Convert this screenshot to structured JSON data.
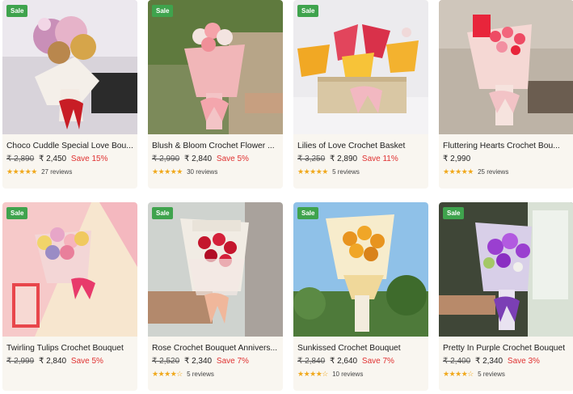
{
  "products": [
    {
      "title": "Choco Cuddle Special Love Bou...",
      "badge": "Sale",
      "old_price": "₹ 2,890",
      "price": "₹ 2,450",
      "save": "Save 15%",
      "stars": "★★★★★",
      "rating": 4.5,
      "reviews": "27 reviews"
    },
    {
      "title": "Blush & Bloom Crochet Flower ...",
      "badge": "Sale",
      "old_price": "₹ 2,990",
      "price": "₹ 2,840",
      "save": "Save 5%",
      "stars": "★★★★★",
      "rating": 4.5,
      "reviews": "30 reviews"
    },
    {
      "title": "Lilies of Love Crochet Basket",
      "badge": "Sale",
      "old_price": "₹ 3,250",
      "price": "₹ 2,890",
      "save": "Save 11%",
      "stars": "★★★★★",
      "rating": 4.5,
      "reviews": "5 reviews"
    },
    {
      "title": "Fluttering Hearts Crochet Bou...",
      "badge": "",
      "old_price": "",
      "price": "₹ 2,990",
      "save": "",
      "stars": "★★★★★",
      "rating": 4.5,
      "reviews": "25 reviews"
    },
    {
      "title": "Twirling Tulips Crochet Bouquet",
      "badge": "Sale",
      "old_price": "₹ 2,999",
      "price": "₹ 2,840",
      "save": "Save 5%",
      "stars": "",
      "rating": 0,
      "reviews": ""
    },
    {
      "title": "Rose Crochet Bouquet Annivers...",
      "badge": "Sale",
      "old_price": "₹ 2,520",
      "price": "₹ 2,340",
      "save": "Save 7%",
      "stars": "★★★★☆",
      "rating": 4.0,
      "reviews": "5 reviews"
    },
    {
      "title": "Sunkissed Crochet Bouquet",
      "badge": "Sale",
      "old_price": "₹ 2,840",
      "price": "₹ 2,640",
      "save": "Save 7%",
      "stars": "★★★★☆",
      "rating": 4.5,
      "reviews": "10 reviews"
    },
    {
      "title": "Pretty In Purple Crochet Bouquet",
      "badge": "Sale",
      "old_price": "₹ 2,400",
      "price": "₹ 2,340",
      "save": "Save 3%",
      "stars": "★★★★☆",
      "rating": 4.0,
      "reviews": "5 reviews"
    }
  ],
  "colors": {
    "sale_badge": "#3fa34d",
    "save_text": "#e03131",
    "star": "#f0a81b",
    "card_bg": "#f9f6f0"
  }
}
